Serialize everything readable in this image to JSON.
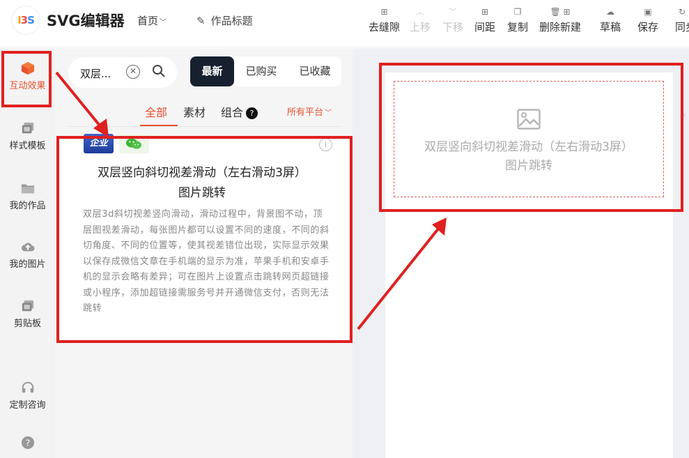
{
  "app": {
    "logo_text": "I3S",
    "title": "SVG编辑器",
    "home_menu": "首页",
    "work_title": "作品标题"
  },
  "toolbar": [
    {
      "label": "去缝隙",
      "icon": "grid-icon",
      "disabled": false
    },
    {
      "label": "上移",
      "icon": "chevron-up-icon",
      "disabled": true
    },
    {
      "label": "下移",
      "icon": "chevron-down-icon",
      "disabled": true
    },
    {
      "label": "间距",
      "icon": "spacing-icon",
      "disabled": false
    },
    {
      "label": "复制",
      "icon": "copy-icon",
      "disabled": false
    },
    {
      "label": "删除新建",
      "icon": "delete-new-icon",
      "disabled": false
    },
    {
      "label": "草稿",
      "icon": "cloud-icon",
      "disabled": false
    },
    {
      "label": "保存",
      "icon": "save-icon",
      "disabled": false
    },
    {
      "label": "同步",
      "icon": "sync-icon",
      "disabled": false
    }
  ],
  "rail": [
    {
      "label": "互动效果",
      "icon": "cube-icon",
      "active": true
    },
    {
      "label": "样式模板",
      "icon": "template-icon",
      "active": false
    },
    {
      "label": "我的作品",
      "icon": "folder-icon",
      "active": false
    },
    {
      "label": "我的图片",
      "icon": "cloud-upload-icon",
      "active": false
    },
    {
      "label": "剪贴板",
      "icon": "clipboard-icon",
      "active": false
    },
    {
      "label": "定制咨询",
      "icon": "headset-icon",
      "active": false
    },
    {
      "label": "",
      "icon": "help-icon",
      "active": false
    }
  ],
  "search": {
    "value": "双层..."
  },
  "sort_tabs": [
    {
      "label": "最新",
      "active": true
    },
    {
      "label": "已购买",
      "active": false
    },
    {
      "label": "已收藏",
      "active": false
    }
  ],
  "filter_tabs": [
    {
      "label": "全部",
      "active": true
    },
    {
      "label": "素材",
      "active": false
    },
    {
      "label": "组合",
      "active": false
    }
  ],
  "platform": "所有平台",
  "card": {
    "badge_enterprise": "企业",
    "title_line1": "双层竖向斜切视差滑动（左右滑动3屏）",
    "title_line2": "图片跳转",
    "description": "双层3d斜切视差竖向滑动，滑动过程中，背景图不动，顶层图视差滑动，每张图片都可以设置不同的速度，不同的斜切角度、不同的位置等，使其视差错位出现，实际显示效果以保存成微信文章在手机端的显示为准，苹果手机和安卓手机的显示会略有差异；可在图片上设置点击跳转网页超链接或小程序，添加超链接需服务号并开通微信支付，否则无法跳转"
  },
  "canvas": {
    "placeholder_line1": "双层竖向斜切视差滑动（左右滑动3屏）",
    "placeholder_line2": "图片跳转"
  },
  "colors": {
    "accent": "#e8502f",
    "annotation": "#e02020",
    "dark": "#16202f"
  }
}
